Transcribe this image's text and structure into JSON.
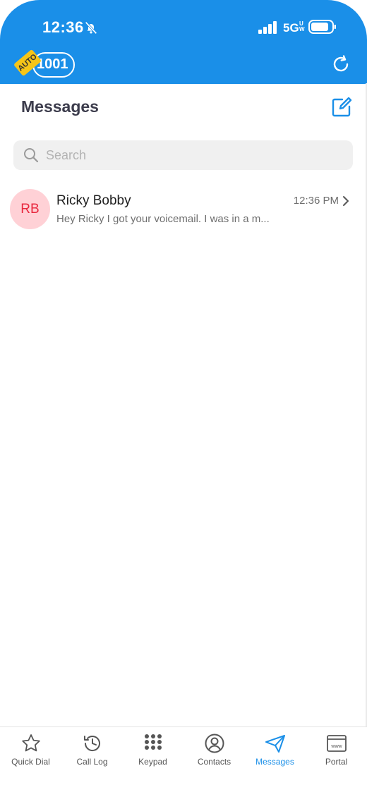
{
  "status_bar": {
    "time": "12:36",
    "network": "5G",
    "network_sup": "UW"
  },
  "header": {
    "auto_badge": "AUTO",
    "extension": "1001"
  },
  "page": {
    "title": "Messages"
  },
  "search": {
    "placeholder": "Search",
    "value": ""
  },
  "messages": [
    {
      "initials": "RB",
      "name": "Ricky Bobby",
      "preview": "Hey Ricky I got your voicemail. I was in a m...",
      "time": "12:36 PM"
    }
  ],
  "tabs": [
    {
      "label": "Quick Dial",
      "icon": "star-icon"
    },
    {
      "label": "Call Log",
      "icon": "history-icon"
    },
    {
      "label": "Keypad",
      "icon": "keypad-icon"
    },
    {
      "label": "Contacts",
      "icon": "contact-icon"
    },
    {
      "label": "Messages",
      "icon": "paper-plane-icon",
      "active": true
    },
    {
      "label": "Portal",
      "icon": "browser-icon"
    }
  ],
  "colors": {
    "accent": "#1a8fe8",
    "avatar_bg": "#ffd1d6",
    "avatar_text": "#e8283e",
    "auto_badge": "#f5c518"
  }
}
